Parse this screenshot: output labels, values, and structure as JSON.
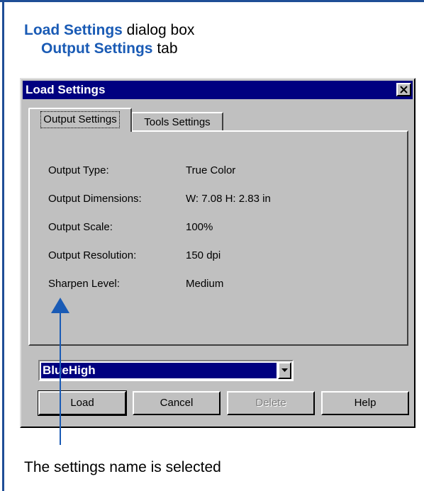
{
  "caption": {
    "title_bold": "Load Settings",
    "title_rest": " dialog box",
    "sub_bold": "Output Settings",
    "sub_rest": " tab",
    "callout": "The settings name is selected"
  },
  "dialog": {
    "title": "Load Settings",
    "tabs": [
      {
        "label": "Output Settings",
        "active": true
      },
      {
        "label": "Tools Settings",
        "active": false
      }
    ],
    "fields": [
      {
        "label": "Output Type:",
        "value": "True Color"
      },
      {
        "label": "Output Dimensions:",
        "value": "W: 7.08 H: 2.83 in"
      },
      {
        "label": "Output Scale:",
        "value": "100%"
      },
      {
        "label": "Output Resolution:",
        "value": "150 dpi"
      },
      {
        "label": "Sharpen Level:",
        "value": "Medium"
      }
    ],
    "combo_value": "BlueHigh",
    "buttons": {
      "load": "Load",
      "cancel": "Cancel",
      "delete": "Delete",
      "help": "Help"
    }
  },
  "colors": {
    "accent": "#1a5bb5",
    "titlebar": "#000080",
    "face": "#c0c0c0"
  }
}
